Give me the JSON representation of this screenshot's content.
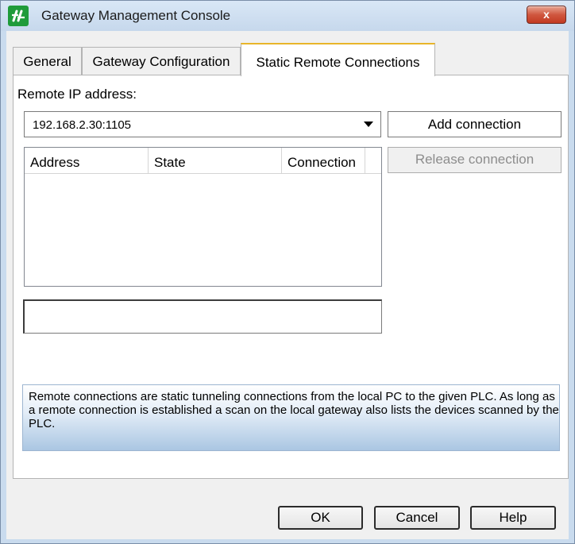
{
  "window": {
    "title": "Gateway Management Console",
    "close_label": "x",
    "accent_color": "#e8b52a",
    "app_icon": "schneider-logo-icon"
  },
  "tabs": [
    {
      "label": "General",
      "active": false
    },
    {
      "label": "Gateway Configuration",
      "active": false
    },
    {
      "label": "Static Remote Connections",
      "active": true
    }
  ],
  "form": {
    "remote_ip_label": "Remote IP address:",
    "remote_ip_value": "192.168.2.30:1105",
    "add_button": "Add connection",
    "release_button": "Release connection",
    "release_enabled": false
  },
  "table": {
    "columns": [
      "Address",
      "State",
      "Connection"
    ],
    "rows": []
  },
  "info_text": "Remote connections are static tunneling connections from the local PC to the given PLC. As long as a remote connection is established a scan on the local gateway also lists the devices scanned by the PLC.",
  "footer": {
    "ok": "OK",
    "cancel": "Cancel",
    "help": "Help"
  }
}
